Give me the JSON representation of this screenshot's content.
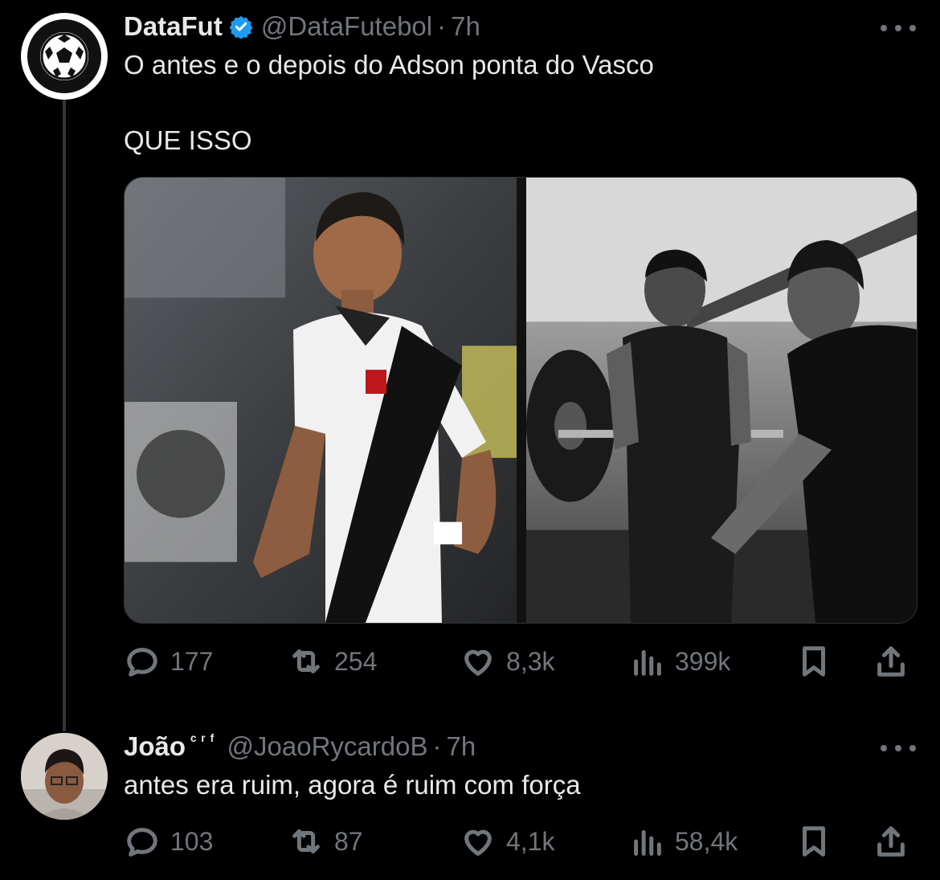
{
  "tweet": {
    "author_name": "DataFut",
    "handle": "@DataFutebol",
    "time": "7h",
    "text_line1": "O antes e o depois do Adson ponta do Vasco",
    "text_line2": "QUE ISSO",
    "replies": "177",
    "reposts": "254",
    "likes": "8,3k",
    "views": "399k",
    "verified": true
  },
  "reply": {
    "author_name": "João",
    "author_suffix": "ᶜʳᶠ",
    "handle": "@JoaoRycardoB",
    "time": "7h",
    "text": "antes era ruim, agora é ruim com força",
    "replies": "103",
    "reposts": "87",
    "likes": "4,1k",
    "views": "58,4k"
  },
  "icons": [
    "soccer-ball-icon",
    "verified-badge-icon",
    "more-icon",
    "reply-icon",
    "repost-icon",
    "like-icon",
    "views-icon",
    "bookmark-icon",
    "share-icon"
  ],
  "colors": {
    "background": "#000000",
    "text": "#e7e9ea",
    "muted": "#71767b",
    "verified": "#1d9bf0"
  }
}
